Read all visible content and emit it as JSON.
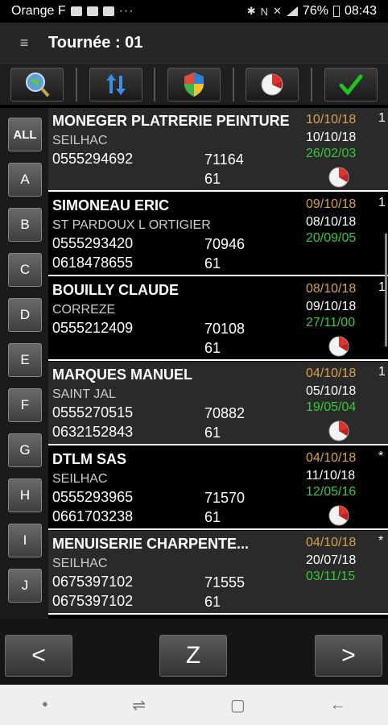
{
  "statusbar": {
    "carrier": "Orange F",
    "dots": "···",
    "battery": "76%",
    "time": "08:43"
  },
  "header": {
    "menu_icon": "≡",
    "title": "Tournée : 01"
  },
  "toolbar": {
    "buttons": [
      {
        "icon": "globe-search-icon"
      },
      {
        "icon": "sort-arrows-icon"
      },
      {
        "icon": "shield-icon"
      },
      {
        "icon": "pie-chart-icon"
      },
      {
        "icon": "checkmark-icon"
      }
    ]
  },
  "alphabet": [
    "ALL",
    "A",
    "B",
    "C",
    "D",
    "E",
    "F",
    "G",
    "H",
    "I",
    "J"
  ],
  "clients": [
    {
      "name": "MONEGER PLATRERIE PEINTURE",
      "city": "SEILHAC",
      "phone1": "0555294692",
      "phone2": "",
      "code": "71164",
      "dept": "61",
      "date1": "10/10/18",
      "date2": "10/10/18",
      "date3": "26/02/03",
      "mark": "1",
      "pie": true
    },
    {
      "name": "SIMONEAU ERIC",
      "city": "ST PARDOUX L ORTIGIER",
      "phone1": "0555293420",
      "phone2": "0618478655",
      "code": "70946",
      "dept": "61",
      "date1": "09/10/18",
      "date2": "08/10/18",
      "date3": "20/09/05",
      "mark": "1",
      "pie": false
    },
    {
      "name": "BOUILLY CLAUDE",
      "city": "CORREZE",
      "phone1": "0555212409",
      "phone2": "",
      "code": "70108",
      "dept": "61",
      "date1": "08/10/18",
      "date2": "09/10/18",
      "date3": "27/11/00",
      "mark": "1",
      "pie": true
    },
    {
      "name": "MARQUES  MANUEL",
      "city": "SAINT JAL",
      "phone1": "0555270515",
      "phone2": "0632152843",
      "code": "70882",
      "dept": "61",
      "date1": "04/10/18",
      "date2": "05/10/18",
      "date3": "19/05/04",
      "mark": "1",
      "pie": true
    },
    {
      "name": "DTLM SAS",
      "city": "SEILHAC",
      "phone1": "0555293965",
      "phone2": "0661703238",
      "code": "71570",
      "dept": "61",
      "date1": "04/10/18",
      "date2": "11/10/18",
      "date3": "12/05/16",
      "mark": "*",
      "pie": true
    },
    {
      "name": "MENUISERIE CHARPENTE...",
      "city": "SEILHAC",
      "phone1": "0675397102",
      "phone2": "0675397102",
      "code": "71555",
      "dept": "61",
      "date1": "04/10/18",
      "date2": "20/07/18",
      "date3": "03/11/15",
      "mark": "*",
      "pie": false
    }
  ],
  "bottom": {
    "prev_label": "<",
    "z_label": "Z",
    "next_label": ">"
  },
  "sysnav": {
    "dot": "•",
    "recent": "⇌",
    "home": "▢",
    "back": "←"
  },
  "colors": {
    "date_orange": "#d9a24a",
    "date_green": "#37c837",
    "checkmark_green": "#22c022"
  }
}
